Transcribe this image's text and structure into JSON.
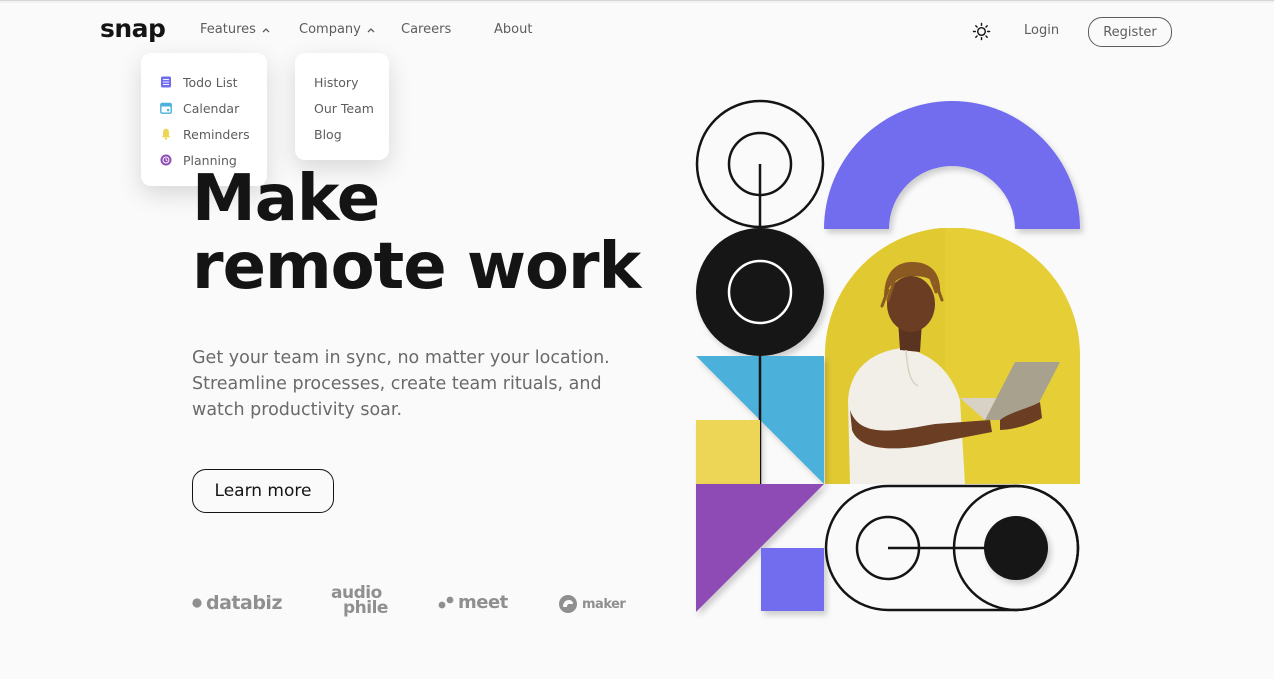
{
  "brand": {
    "logo": "snap"
  },
  "nav": {
    "features": "Features",
    "company": "Company",
    "careers": "Careers",
    "about": "About",
    "login": "Login",
    "register": "Register"
  },
  "dropdowns": {
    "features": [
      {
        "label": "Todo List",
        "icon": "todo-list-icon",
        "color": "#726cee"
      },
      {
        "label": "Calendar",
        "icon": "calendar-icon",
        "color": "#4bb1da"
      },
      {
        "label": "Reminders",
        "icon": "bell-icon",
        "color": "#edd556"
      },
      {
        "label": "Planning",
        "icon": "planning-icon",
        "color": "#8e4cb6"
      }
    ],
    "company": [
      {
        "label": "History"
      },
      {
        "label": "Our Team"
      },
      {
        "label": "Blog"
      }
    ]
  },
  "hero": {
    "headline_line1": "Make",
    "headline_line2": "remote work",
    "description": "Get your team in sync, no matter your location. Streamline processes, create team rituals, and watch productivity soar.",
    "cta": "Learn more"
  },
  "clients": [
    {
      "name": "databiz"
    },
    {
      "name": "audio"
    },
    {
      "name": "phile"
    },
    {
      "name": "meet"
    },
    {
      "name": "maker"
    }
  ],
  "colors": {
    "purple": "#726cee",
    "blue": "#4bb1da",
    "yellow": "#edd556",
    "violet": "#8e4cb6",
    "dark": "#141414"
  }
}
